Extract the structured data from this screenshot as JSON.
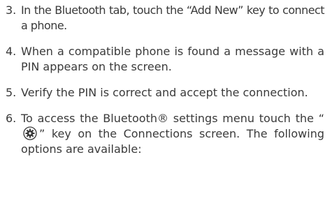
{
  "steps": [
    {
      "number": "3.",
      "text": "In the Bluetooth tab, touch the “Add New” key to connect a phone."
    },
    {
      "number": "4.",
      "text": "When a compatible phone is found a message with a PIN appears on the screen."
    },
    {
      "number": "5.",
      "text": "Verify the PIN is correct and accept the connection."
    },
    {
      "number": "6.",
      "text_before_icon": "To access the Bluetooth® settings menu touch the “",
      "icon": "gear-icon",
      "text_after_icon": "” key on the Connections screen. The following options are available:"
    }
  ]
}
